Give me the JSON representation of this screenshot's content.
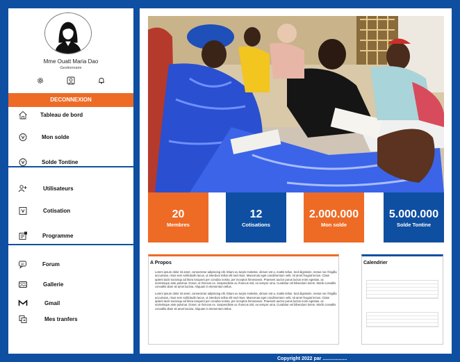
{
  "user": {
    "name": "Mme Ouatt Maria Dao",
    "role": "Gestionnaire"
  },
  "quick_icons": [
    "gear-icon",
    "profile-icon",
    "bell-icon"
  ],
  "logout_label": "DECONNEXION",
  "nav": {
    "group1": [
      {
        "label": "Tableau de bord",
        "icon": "home-icon"
      },
      {
        "label": "Mon solde",
        "icon": "coin-icon"
      },
      {
        "label": "Solde Tontine",
        "icon": "coin-icon"
      }
    ],
    "group2": [
      {
        "label": "Utilisateurs",
        "icon": "add-user-icon"
      },
      {
        "label": "Cotisation",
        "icon": "wallet-icon"
      },
      {
        "label": "Programme",
        "icon": "calendar-icon"
      }
    ],
    "group3": [
      {
        "label": "Forum",
        "icon": "chat-icon"
      },
      {
        "label": "Gallerie",
        "icon": "image-icon"
      },
      {
        "label": "Gmail",
        "icon": "mail-icon"
      },
      {
        "label": "Mes tranfers",
        "icon": "transfer-icon"
      }
    ]
  },
  "stats": [
    {
      "value": "20",
      "label": "Membres",
      "color": "#ee6b26"
    },
    {
      "value": "12",
      "label": "Cotisations",
      "color": "#0f4fa1"
    },
    {
      "value": "2.000.000",
      "label": "Mon solde",
      "color": "#ee6b26"
    },
    {
      "value": "5.000.000",
      "label": "Solde Tontine",
      "color": "#0f4fa1"
    }
  ],
  "about": {
    "title": "A Propos",
    "p1": "Lorem ipsum dolor sit amet, consectetur adipiscing elit. Etiam eu turpis molestie, dictum est a, mattis tellus. Sed dignissim, metus nec fringilla accumsan, risus sem sollicitudin lacus, ut interdum tellus elit sed risus. Maecenas eget condimentum velit, sit amet feugiat lectus. Class aptent taciti sociosqu ad litora torquent per conubia nostra, per inceptos himenaeos. Praesent auctor purus luctus enim egestas, ac scelerisque ante pulvinar. Donec ut rhoncus ex. Suspendisse ac rhoncus nisl, eu tempor urna. Curabitur vel bibendum lorem. Morbi convallis convallis diam sit amet lacinia. Aliquam in elementum tellus.",
    "p2": "Lorem ipsum dolor sit amet, consectetur adipiscing elit. Etiam eu turpis molestie, dictum est a, mattis tellus. Sed dignissim, metus nec fringilla accumsan, risus sem sollicitudin lacus, ut interdum tellus elit sed risus. Maecenas eget condimentum velit, sit amet feugiat lectus. Class aptent taciti sociosqu ad litora torquent per conubia nostra, per inceptos himenaeos. Praesent auctor purus luctus enim egestas, ac scelerisque ante pulvinar. Donec ut rhoncus ex. Suspendisse ac rhoncus nisl, eu tempor urna. Curabitur vel bibendum lorem. Morbi convallis convallis diam sit amet lacinia. Aliquam in elementum tellus."
  },
  "calendar": {
    "title": "Calendrier"
  },
  "footer": "Copyright 2022 par ..................",
  "colors": {
    "brand_blue": "#0f4fa1",
    "accent_orange": "#ee6b26"
  }
}
